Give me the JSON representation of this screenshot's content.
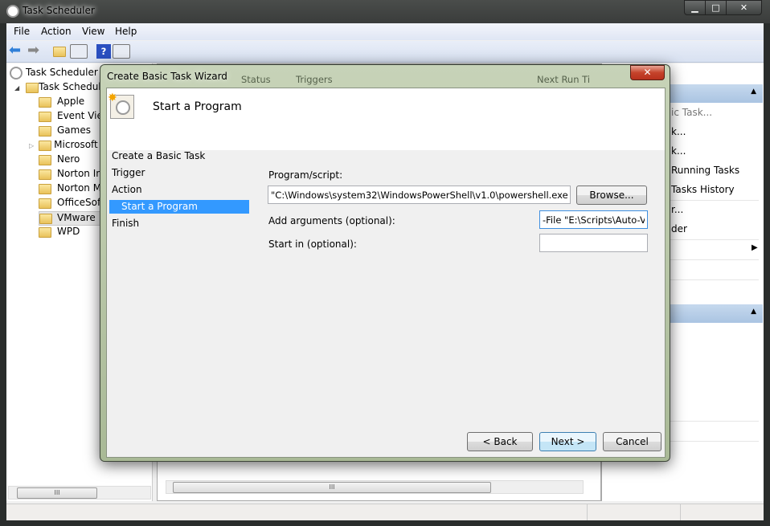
{
  "window": {
    "title": "Task Scheduler",
    "controls": [
      "minimize",
      "maximize",
      "close"
    ]
  },
  "menu": [
    "File",
    "Action",
    "View",
    "Help"
  ],
  "toolbar": [
    "back-icon",
    "forward-icon",
    "up-folder-icon",
    "show-hide-console-tree-icon",
    "help-icon",
    "show-hide-action-pane-icon"
  ],
  "tree": {
    "root": "Task Scheduler (L",
    "library": "Task Schedule",
    "folders": [
      "Apple",
      "Event View",
      "Games",
      "Microsoft",
      "Nero",
      "Norton Int",
      "Norton M",
      "OfficeSoft",
      "VMware",
      "WPD"
    ],
    "selected": "VMware"
  },
  "middle": {
    "columns": [
      "Status",
      "Triggers",
      "Next Run Ti"
    ]
  },
  "actions": {
    "items": [
      "ic Task...",
      "k...",
      "k...",
      "Running Tasks",
      "Tasks History",
      "r...",
      "der"
    ]
  },
  "dialog": {
    "title": "Create Basic Task Wizard",
    "heading": "Start a Program",
    "nav": [
      "Create a Basic Task",
      "Trigger",
      "Action",
      "Start a Program",
      "Finish"
    ],
    "nav_selected": "Start a Program",
    "program_label": "Program/script:",
    "program_value": "\"C:\\Windows\\system32\\WindowsPowerShell\\v1.0\\powershell.exe\"",
    "browse": "Browse...",
    "args_label": "Add arguments (optional):",
    "args_value": "-File \"E:\\Scripts\\Auto-VM",
    "startin_label": "Start in (optional):",
    "startin_value": "",
    "back": "< Back",
    "next": "Next >",
    "cancel": "Cancel"
  },
  "colors": {
    "selection": "#3399ff",
    "action_header": "#b7cde8"
  }
}
